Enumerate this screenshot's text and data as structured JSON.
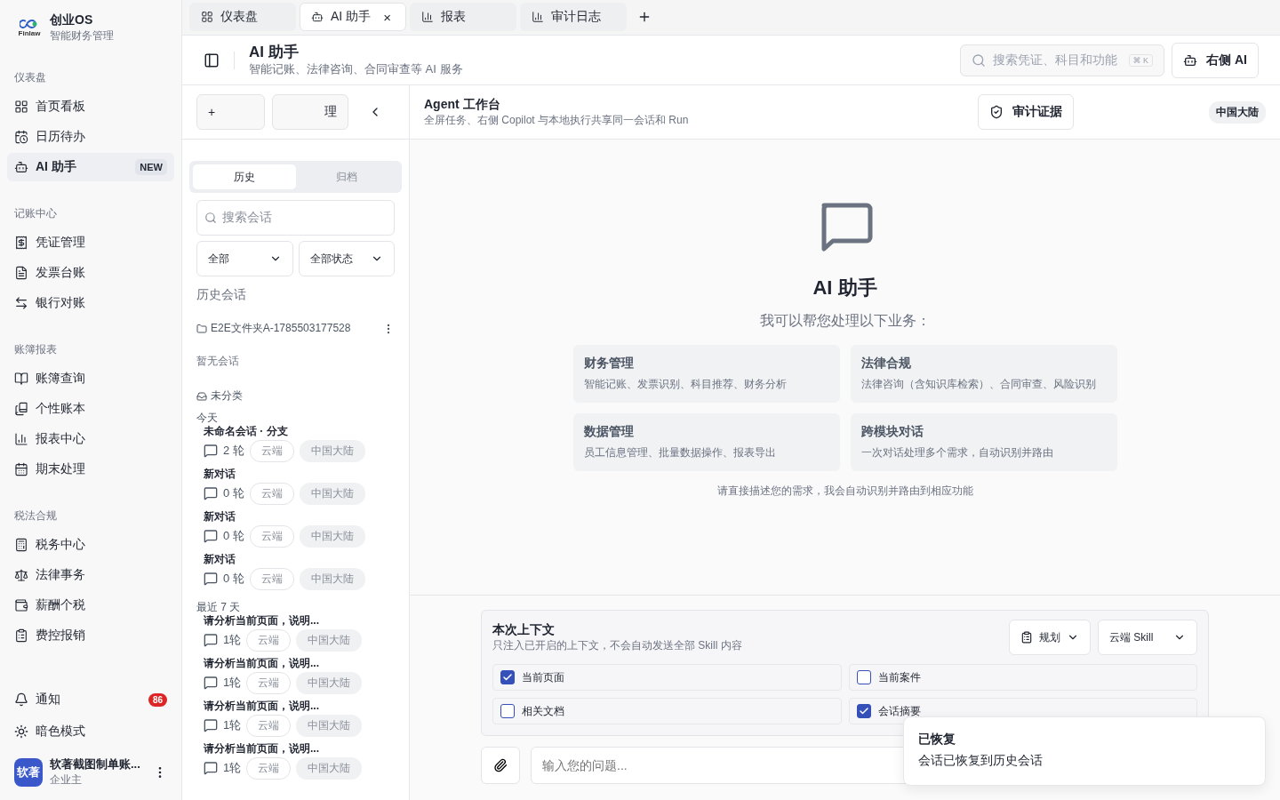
{
  "brand": {
    "name": "创业OS",
    "tagline": "智能财务管理",
    "logo_text": "Finlaw"
  },
  "sidebar": {
    "groups": [
      {
        "title": "仪表盘",
        "items": [
          {
            "label": "首页看板",
            "selected": false
          },
          {
            "label": "日历待办",
            "selected": false
          },
          {
            "label": "AI 助手",
            "selected": true,
            "badge": "NEW"
          }
        ]
      },
      {
        "title": "记账中心",
        "items": [
          {
            "label": "凭证管理",
            "selected": false
          },
          {
            "label": "发票台账",
            "selected": false
          },
          {
            "label": "银行对账",
            "selected": false
          }
        ]
      },
      {
        "title": "账簿报表",
        "items": [
          {
            "label": "账簿查询",
            "selected": false
          },
          {
            "label": "个性账本",
            "selected": false
          },
          {
            "label": "报表中心",
            "selected": false
          },
          {
            "label": "期末处理",
            "selected": false
          }
        ]
      },
      {
        "title": "税法合规",
        "items": [
          {
            "label": "税务中心",
            "selected": false
          },
          {
            "label": "法律事务",
            "selected": false
          },
          {
            "label": "薪酬个税",
            "selected": false
          },
          {
            "label": "费控报销",
            "selected": false
          }
        ]
      }
    ],
    "notifications": {
      "label": "通知",
      "count": "86"
    },
    "dark_mode": {
      "label": "暗色模式"
    },
    "user": {
      "avatar": "软著",
      "name": "软著截图制单账...",
      "role": "企业主"
    }
  },
  "tabs": [
    {
      "label": "仪表盘",
      "selected": false
    },
    {
      "label": "AI 助手",
      "selected": true,
      "close": "×"
    },
    {
      "label": "报表",
      "selected": false
    },
    {
      "label": "审计日志",
      "selected": false
    }
  ],
  "header": {
    "title": "AI 助手",
    "subtitle": "智能记账、法律咨询、合同审查等 AI 服务",
    "search_placeholder": "搜索凭证、科目和功能",
    "shortcut": "⌘ K",
    "right_button": "右侧 AI"
  },
  "history_panel": {
    "new_button": "+",
    "manage_button": "理",
    "view_tabs": [
      {
        "label": "历史",
        "selected": true
      },
      {
        "label": "归档",
        "selected": false
      }
    ],
    "search_placeholder": "搜索会话",
    "filters": [
      "全部",
      "全部状态"
    ],
    "section_title": "历史会话",
    "folder": "E2E文件夹A-1785503177528",
    "folder_empty": "暂无会话",
    "uncategorized": "未分类",
    "groups": [
      {
        "title": "今天",
        "sessions": [
          {
            "title": "未命名会话 · 分支",
            "turns": "2 轮",
            "tags": [
              "云端",
              "中国大陆"
            ]
          },
          {
            "title": "新对话",
            "turns": "0 轮",
            "tags": [
              "云端",
              "中国大陆"
            ]
          },
          {
            "title": "新对话",
            "turns": "0 轮",
            "tags": [
              "云端",
              "中国大陆"
            ]
          },
          {
            "title": "新对话",
            "turns": "0 轮",
            "tags": [
              "云端",
              "中国大陆"
            ]
          }
        ]
      },
      {
        "title": "最近 7 天",
        "sessions": [
          {
            "title": "请分析当前页面，说明...",
            "turns": "1轮",
            "tags": [
              "云端",
              "中国大陆"
            ]
          },
          {
            "title": "请分析当前页面，说明...",
            "turns": "1轮",
            "tags": [
              "云端",
              "中国大陆"
            ]
          },
          {
            "title": "请分析当前页面，说明...",
            "turns": "1轮",
            "tags": [
              "云端",
              "中国大陆"
            ]
          },
          {
            "title": "请分析当前页面，说明...",
            "turns": "1轮",
            "tags": [
              "云端",
              "中国大陆"
            ]
          }
        ]
      }
    ]
  },
  "workspace": {
    "title": "Agent 工作台",
    "subtitle": "全屏任务、右侧 Copilot 与本地执行共享同一会话和 Run",
    "audit_button": "审计证据",
    "region": "中国大陆"
  },
  "welcome": {
    "title": "AI 助手",
    "intro": "我可以帮您处理以下业务：",
    "cards": [
      {
        "title": "财务管理",
        "desc": "智能记账、发票识别、科目推荐、财务分析"
      },
      {
        "title": "法律合规",
        "desc": "法律咨询（含知识库检索）、合同审查、风险识别"
      },
      {
        "title": "数据管理",
        "desc": "员工信息管理、批量数据操作、报表导出"
      },
      {
        "title": "跨模块对话",
        "desc": "一次对话处理多个需求，自动识别并路由"
      }
    ],
    "hint": "请直接描述您的需求，我会自动识别并路由到相应功能"
  },
  "context": {
    "title": "本次上下文",
    "subtitle": "只注入已开启的上下文，不会自动发送全部 Skill 内容",
    "mode": "规划",
    "skill": "云端 Skill",
    "options": [
      {
        "label": "当前页面",
        "checked": true
      },
      {
        "label": "当前案件",
        "checked": false
      },
      {
        "label": "相关文档",
        "checked": false
      },
      {
        "label": "会话摘要",
        "checked": true
      }
    ]
  },
  "composer": {
    "placeholder": "输入您的问题..."
  },
  "toast": {
    "title": "已恢复",
    "message": "会话已恢复到历史会话"
  }
}
